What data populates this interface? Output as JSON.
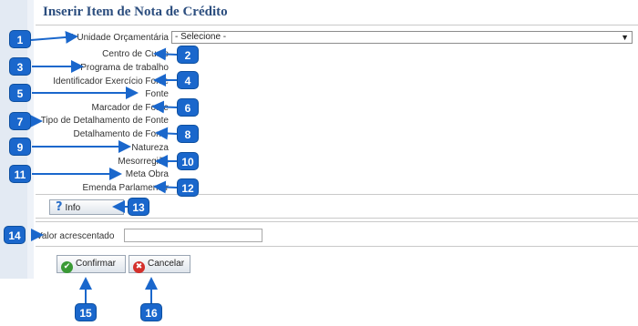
{
  "form": {
    "title": "Inserir Item de Nota de Crédito",
    "required_mark": "*",
    "fields": [
      "Unidade Orçamentária",
      "Centro de Custo",
      "Programa de trabalho",
      "Identificador Exercício Fonte",
      "Fonte",
      "Marcador de Fonte",
      "Tipo de Detalhamento de Fonte",
      "Detalhamento de Fonte",
      "Natureza",
      "Mesorregião",
      "Meta Obra",
      "Emenda Parlamentar"
    ],
    "unidade_select_value": "- Selecione -",
    "info_label": "Info",
    "valor_label": "Valor acrescentado",
    "valor_value": "",
    "confirm_label": "Confirmar",
    "cancel_label": "Cancelar"
  },
  "callouts": [
    "1",
    "2",
    "3",
    "4",
    "5",
    "6",
    "7",
    "8",
    "9",
    "10",
    "11",
    "12",
    "13",
    "14",
    "15",
    "16"
  ],
  "colors": {
    "title": "#2b4d7e",
    "badge": "#1a67cc",
    "confirm_icon": "#3a9a35",
    "cancel_icon": "#d4302b"
  }
}
